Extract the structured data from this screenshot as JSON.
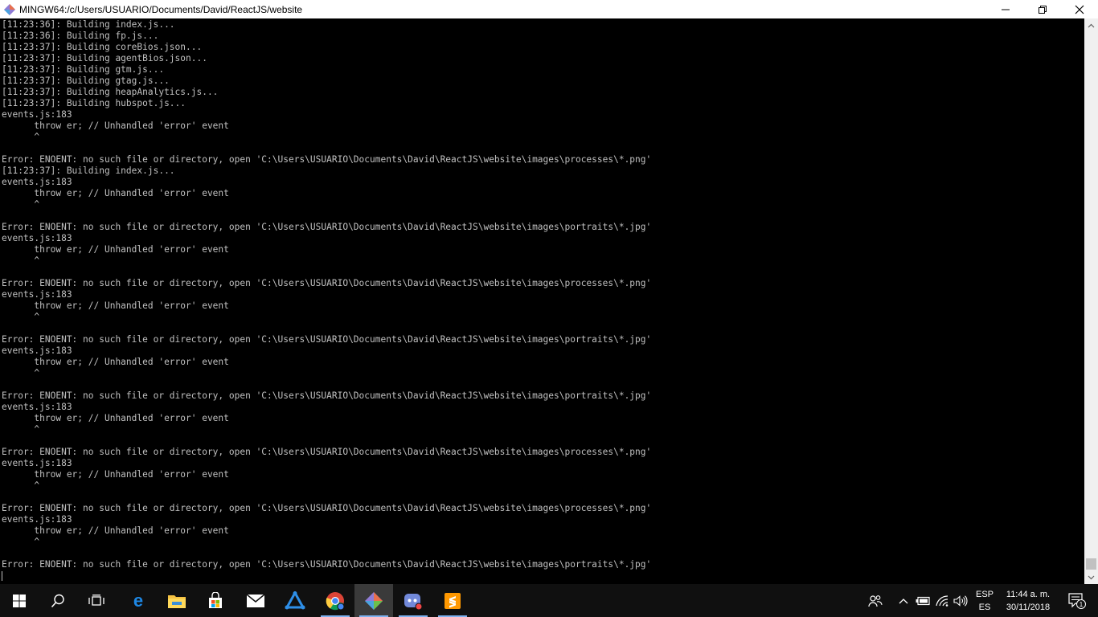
{
  "window": {
    "title": "MINGW64:/c/Users/USUARIO/Documents/David/ReactJS/website",
    "minimize": "—",
    "maximize": "❐",
    "close": "✕"
  },
  "terminal": {
    "lines": [
      "[11:23:36]: Building index.js...",
      "[11:23:36]: Building fp.js...",
      "[11:23:37]: Building coreBios.json...",
      "[11:23:37]: Building agentBios.json...",
      "[11:23:37]: Building gtm.js...",
      "[11:23:37]: Building gtag.js...",
      "[11:23:37]: Building heapAnalytics.js...",
      "[11:23:37]: Building hubspot.js...",
      "events.js:183",
      "      throw er; // Unhandled 'error' event",
      "      ^",
      "",
      "Error: ENOENT: no such file or directory, open 'C:\\Users\\USUARIO\\Documents\\David\\ReactJS\\website\\images\\processes\\*.png'",
      "[11:23:37]: Building index.js...",
      "events.js:183",
      "      throw er; // Unhandled 'error' event",
      "      ^",
      "",
      "Error: ENOENT: no such file or directory, open 'C:\\Users\\USUARIO\\Documents\\David\\ReactJS\\website\\images\\portraits\\*.jpg'",
      "events.js:183",
      "      throw er; // Unhandled 'error' event",
      "      ^",
      "",
      "Error: ENOENT: no such file or directory, open 'C:\\Users\\USUARIO\\Documents\\David\\ReactJS\\website\\images\\processes\\*.png'",
      "events.js:183",
      "      throw er; // Unhandled 'error' event",
      "      ^",
      "",
      "Error: ENOENT: no such file or directory, open 'C:\\Users\\USUARIO\\Documents\\David\\ReactJS\\website\\images\\portraits\\*.jpg'",
      "events.js:183",
      "      throw er; // Unhandled 'error' event",
      "      ^",
      "",
      "Error: ENOENT: no such file or directory, open 'C:\\Users\\USUARIO\\Documents\\David\\ReactJS\\website\\images\\portraits\\*.jpg'",
      "events.js:183",
      "      throw er; // Unhandled 'error' event",
      "      ^",
      "",
      "Error: ENOENT: no such file or directory, open 'C:\\Users\\USUARIO\\Documents\\David\\ReactJS\\website\\images\\processes\\*.png'",
      "events.js:183",
      "      throw er; // Unhandled 'error' event",
      "      ^",
      "",
      "Error: ENOENT: no such file or directory, open 'C:\\Users\\USUARIO\\Documents\\David\\ReactJS\\website\\images\\processes\\*.png'",
      "events.js:183",
      "      throw er; // Unhandled 'error' event",
      "      ^",
      "",
      "Error: ENOENT: no such file or directory, open 'C:\\Users\\USUARIO\\Documents\\David\\ReactJS\\website\\images\\portraits\\*.jpg'"
    ]
  },
  "taskbar": {
    "icons": [
      "windows-start-icon",
      "search-icon",
      "task-view-icon",
      "edge-icon",
      "file-explorer-icon",
      "store-icon",
      "mail-icon",
      "app-icon",
      "chrome-icon",
      "git-bash-icon",
      "discord-icon",
      "sublime-text-icon"
    ],
    "tray": {
      "lang_top": "ESP",
      "lang_bottom": "ES",
      "time": "11:44 a. m.",
      "date": "30/11/2018",
      "notifications": "1"
    }
  },
  "colors": {
    "terminal_bg": "#000000",
    "terminal_fg": "#c0c0c0",
    "taskbar_bg": "#101010",
    "accent": "#7fb2f0"
  }
}
